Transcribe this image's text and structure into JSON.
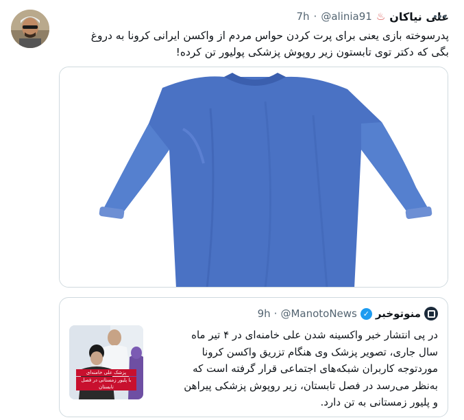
{
  "tweet": {
    "author": {
      "display_name": "علی نیاکان",
      "name_emoji": "♨",
      "handle": "@alinia91",
      "separator": "·",
      "time": "7h"
    },
    "text_line_1": "پدرسوخته بازی یعنی برای پرت کردن حواس مردم از واکسن ایرانی کرونا به دروغ",
    "text_line_2": "بگی که دکتر توی تابستون زیر روپوش پزشکی پولیور تن کرده!",
    "media": {
      "alt_subject": "blue medical gown",
      "color": "#4a72c4"
    }
  },
  "quoted_tweet": {
    "author": {
      "display_name": "منوتوخبر",
      "handle": "@ManotoNews",
      "separator": "·",
      "time": "9h",
      "verified_icon": "verified-badge-icon",
      "verified_glyph": "✓"
    },
    "text_lines": [
      "در پی انتشار خبر واکسینه شدن علی خامنه‌ای در ۴ تیر ماه",
      "سال جاری، تصویر پزشک وی هنگام تزریق واکسن کرونا",
      "موردتوجه کاربران شبکه‌های اجتماعی قرار گرفته است که",
      "به‌نظر می‌رسد در فصل تابستان، زیر روپوش پزشکی پیراهن",
      "و پلیور زمستانی به تن دارد."
    ],
    "thumbnail_caption": [
      "پزشک علی خامنه‌ای",
      "با پلیور زمستانی در فصل تابستان"
    ]
  },
  "colors": {
    "text": "#0f1419",
    "secondary": "#536471",
    "border": "#cfd9de",
    "verified": "#1d9bf0",
    "gown": "#4a72c4"
  }
}
